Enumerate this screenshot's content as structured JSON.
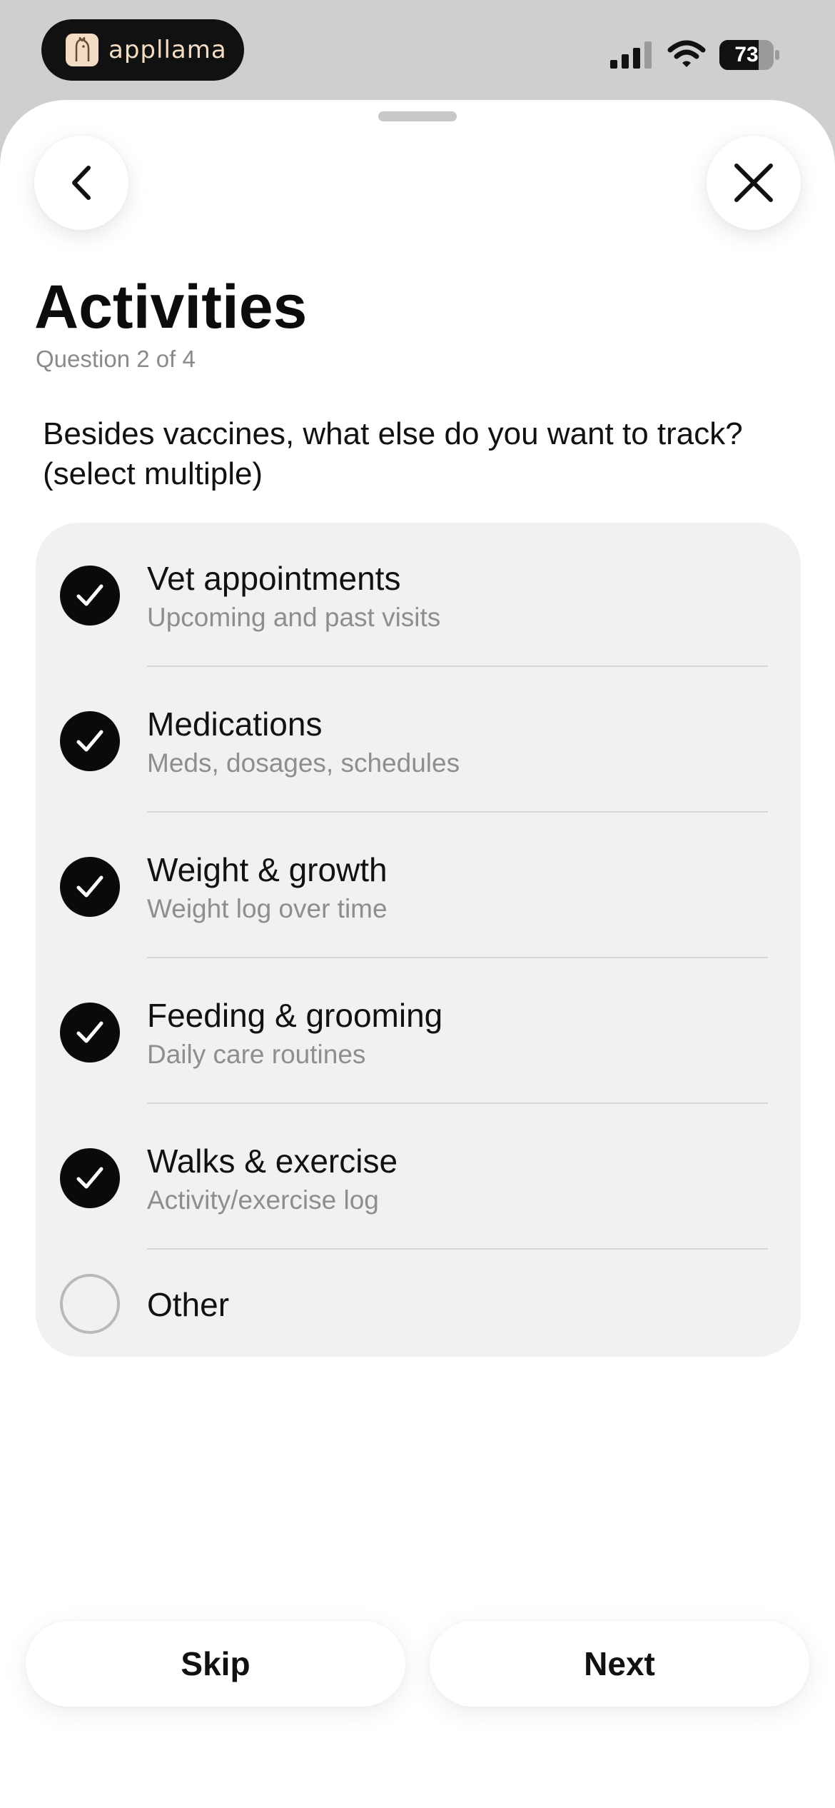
{
  "status_bar": {
    "brand": "appllama",
    "battery_level": "73",
    "battery_fraction": 0.73,
    "icons": [
      "cellular-signal-icon",
      "wifi-icon",
      "battery-icon"
    ]
  },
  "header": {
    "back_icon": "chevron-left-icon",
    "close_icon": "close-icon"
  },
  "page": {
    "title": "Activities",
    "subtitle": "Question 2 of 4",
    "question": "Besides vaccines, what else do you want to track? (select multiple)"
  },
  "options": [
    {
      "label": "Vet appointments",
      "description": "Upcoming and past visits",
      "checked": true
    },
    {
      "label": "Medications",
      "description": "Meds, dosages, schedules",
      "checked": true
    },
    {
      "label": "Weight & growth",
      "description": "Weight log over time",
      "checked": true
    },
    {
      "label": "Feeding & grooming",
      "description": "Daily care routines",
      "checked": true
    },
    {
      "label": "Walks & exercise",
      "description": "Activity/exercise log",
      "checked": true
    },
    {
      "label": "Other",
      "description": "",
      "checked": false
    }
  ],
  "footer": {
    "skip_label": "Skip",
    "next_label": "Next"
  },
  "colors": {
    "checked": "#0a0a0a",
    "card_background": "#f1f1f1",
    "secondary_text": "#8e8e8e"
  }
}
